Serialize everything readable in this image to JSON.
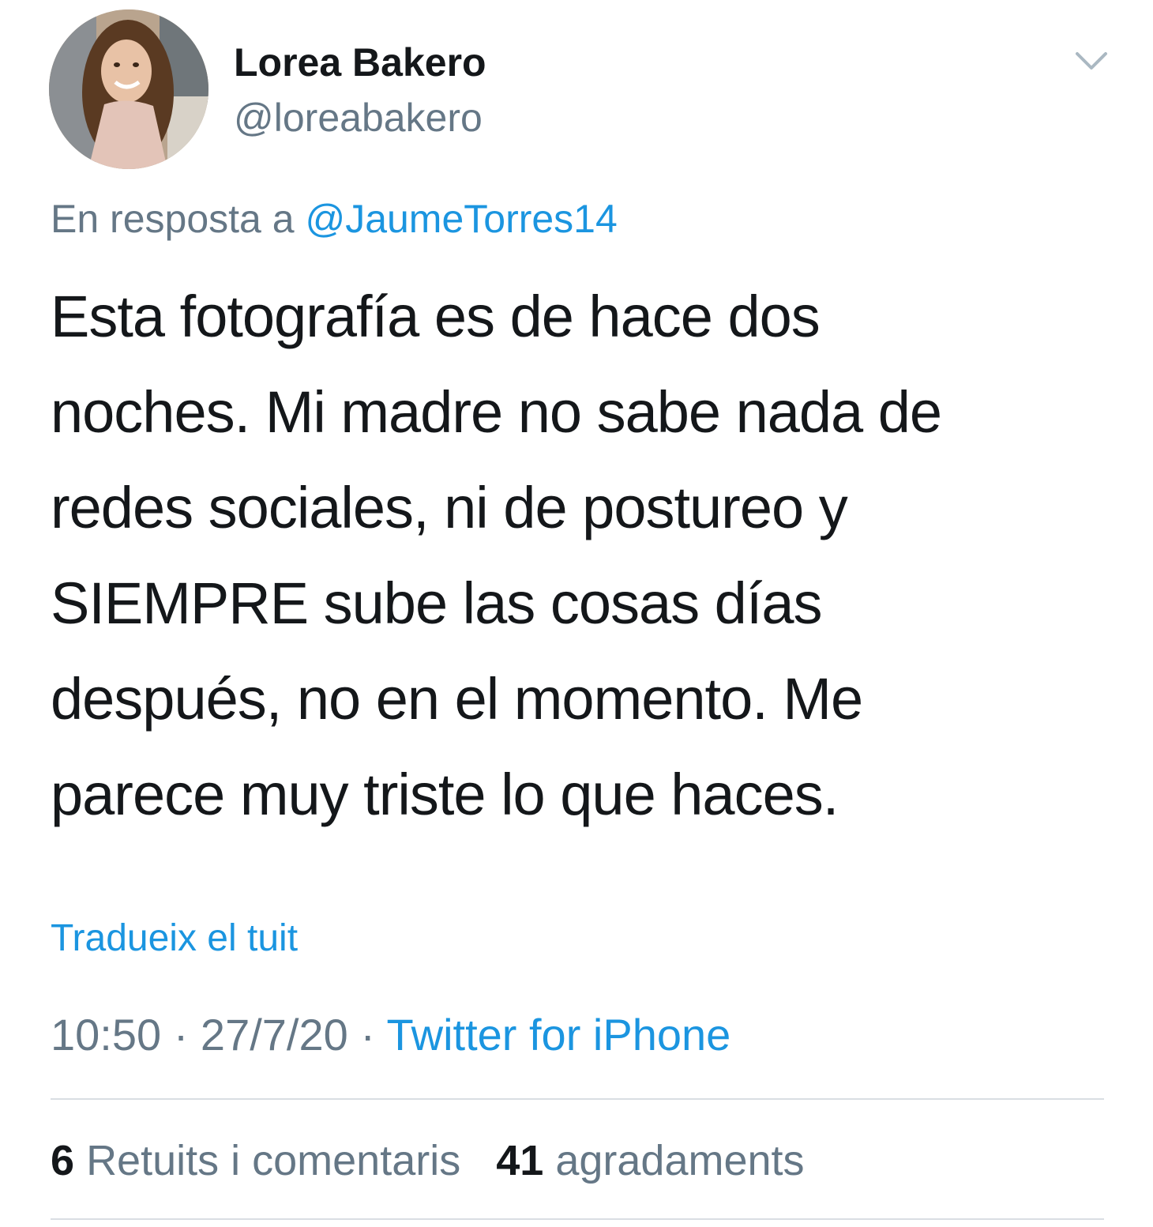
{
  "author": {
    "display_name": "Lorea Bakero",
    "handle": "@loreabakero"
  },
  "icons": {
    "avatar": "profile-photo",
    "menu": "chevron-down-icon"
  },
  "reply": {
    "prefix": "En resposta a",
    "mention": "@JaumeTorres14"
  },
  "tweet": {
    "lines": [
      "Esta fotografía es de hace dos",
      "noches. Mi madre no sabe nada de",
      "redes sociales, ni de postureo y",
      "SIEMPRE sube las cosas días",
      "después, no en el momento. Me",
      "parece muy triste lo que haces."
    ]
  },
  "translate_label": "Tradueix el tuit",
  "meta": {
    "time": "10:50",
    "separator": "·",
    "date": "27/7/20",
    "source": "Twitter for iPhone"
  },
  "stats": {
    "retweets_count": "6",
    "retweets_label": "Retuits i comentaris",
    "likes_count": "41",
    "likes_label": "agradaments"
  },
  "colors": {
    "text": "#14171a",
    "secondary": "#657786",
    "link": "#1b95e0",
    "divider": "#d9dee3"
  }
}
